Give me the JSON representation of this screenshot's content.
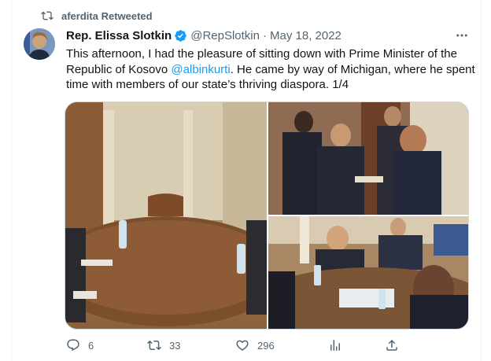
{
  "social_context": {
    "text": "aferdita Retweeted",
    "icon": "retweet-icon"
  },
  "tweet": {
    "author_name": "Rep. Elissa Slotkin",
    "verified": true,
    "handle": "@RepSlotkin",
    "separator": "·",
    "date": "May 18, 2022",
    "text_part1": "This afternoon, I had the pleasure of sitting down with Prime Minister of the Republic of Kosovo ",
    "mention": "@albinkurti",
    "text_part2": ". He came by way of Michigan, where he spent time with members of our state’s thriving diaspora. 1/4"
  },
  "media": [
    {
      "name": "photo-meeting-table",
      "description_icon": "photo"
    },
    {
      "name": "photo-handshake",
      "description_icon": "photo"
    },
    {
      "name": "photo-map-discussion",
      "description_icon": "photo"
    }
  ],
  "actions": {
    "reply_count": "6",
    "retweet_count": "33",
    "like_count": "296"
  },
  "colors": {
    "accent": "#1d9bf0",
    "secondary_text": "#536471",
    "primary_text": "#0f1419",
    "border": "#cfd9de"
  }
}
